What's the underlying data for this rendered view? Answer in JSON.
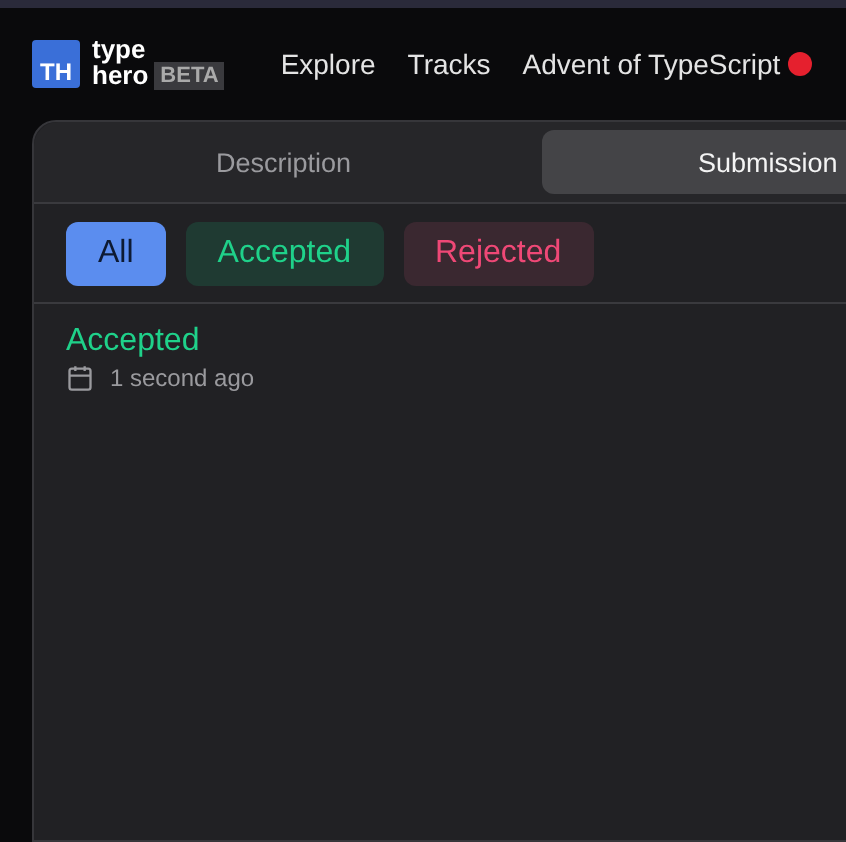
{
  "logo": {
    "mark": "TH",
    "line_1": "type",
    "line_2": "hero",
    "badge": "BETA"
  },
  "nav": [
    {
      "label": "Explore"
    },
    {
      "label": "Tracks"
    },
    {
      "label": "Advent of TypeScript"
    }
  ],
  "tabs": [
    {
      "label": "Description",
      "selected": false
    },
    {
      "label": "Submission",
      "selected": true
    }
  ],
  "filters": [
    {
      "label": "All",
      "kind": "all",
      "selected": true
    },
    {
      "label": "Accepted",
      "kind": "accepted",
      "selected": false
    },
    {
      "label": "Rejected",
      "kind": "rejected",
      "selected": false
    }
  ],
  "submissions": [
    {
      "status": "Accepted",
      "kind": "accepted",
      "time": "1 second ago"
    }
  ]
}
